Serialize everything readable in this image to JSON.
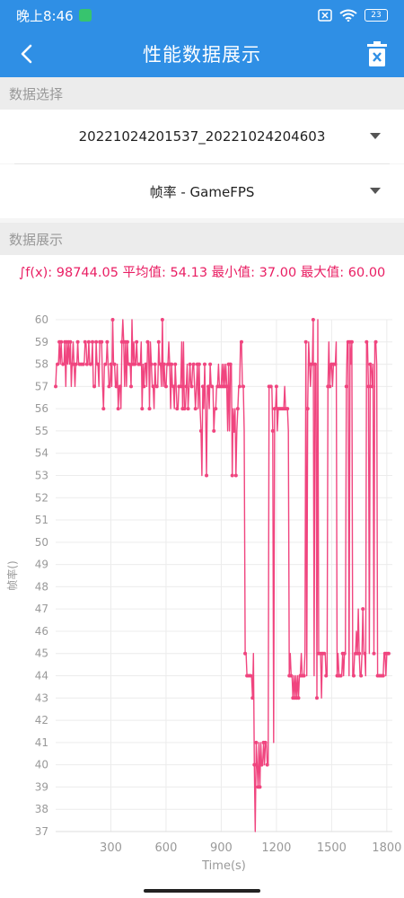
{
  "status_bar": {
    "time": "晚上8:46",
    "battery": "23"
  },
  "app_bar": {
    "title": "性能数据展示"
  },
  "data_select": {
    "section_label": "数据选择",
    "file_value": "20221024201537_20221024204603",
    "metric_value": "帧率 - GameFPS"
  },
  "data_display": {
    "section_label": "数据展示",
    "stats_text": "∫f(x): 98744.05 平均值: 54.13 最小值: 37.00 最大值: 60.00"
  },
  "chart_data": {
    "type": "line",
    "xlabel": "Time(s)",
    "ylabel": "帧率()",
    "xlim": [
      0,
      1830
    ],
    "ylim": [
      37,
      60
    ],
    "x_ticks": [
      300,
      600,
      900,
      1200,
      1500,
      1800
    ],
    "y_ticks": [
      37,
      38,
      39,
      40,
      41,
      42,
      43,
      44,
      45,
      46,
      47,
      48,
      49,
      50,
      51,
      52,
      53,
      54,
      55,
      56,
      57,
      58,
      59,
      60
    ],
    "color": "#f0457f",
    "segments": [
      {
        "t0": 0,
        "t1": 640,
        "lo": 57,
        "hi": 59,
        "min": 56,
        "max": 60
      },
      {
        "t0": 640,
        "t1": 1030,
        "lo": 55,
        "hi": 58,
        "min": 53,
        "max": 59
      },
      {
        "t0": 1030,
        "t1": 1080,
        "lo": 44,
        "hi": 45,
        "min": 43,
        "max": 46
      },
      {
        "t0": 1080,
        "t1": 1160,
        "lo": 39,
        "hi": 41,
        "min": 37,
        "max": 41
      },
      {
        "t0": 1160,
        "t1": 1270,
        "lo": 55,
        "hi": 57,
        "min": 41,
        "max": 58
      },
      {
        "t0": 1270,
        "t1": 1360,
        "lo": 43,
        "hi": 45,
        "min": 37,
        "max": 45
      },
      {
        "t0": 1360,
        "t1": 1420,
        "lo": 56,
        "hi": 59,
        "min": 44,
        "max": 60
      },
      {
        "t0": 1420,
        "t1": 1480,
        "lo": 44,
        "hi": 45,
        "min": 43,
        "max": 60
      },
      {
        "t0": 1480,
        "t1": 1530,
        "lo": 57,
        "hi": 59,
        "min": 44,
        "max": 60
      },
      {
        "t0": 1530,
        "t1": 1580,
        "lo": 44,
        "hi": 45,
        "min": 43,
        "max": 46
      },
      {
        "t0": 1580,
        "t1": 1620,
        "lo": 57,
        "hi": 59,
        "min": 44,
        "max": 60
      },
      {
        "t0": 1620,
        "t1": 1690,
        "lo": 44,
        "hi": 46,
        "min": 43,
        "max": 47
      },
      {
        "t0": 1690,
        "t1": 1750,
        "lo": 57,
        "hi": 59,
        "min": 45,
        "max": 60
      },
      {
        "t0": 1750,
        "t1": 1820,
        "lo": 44,
        "hi": 45,
        "min": 44,
        "max": 59
      }
    ]
  }
}
